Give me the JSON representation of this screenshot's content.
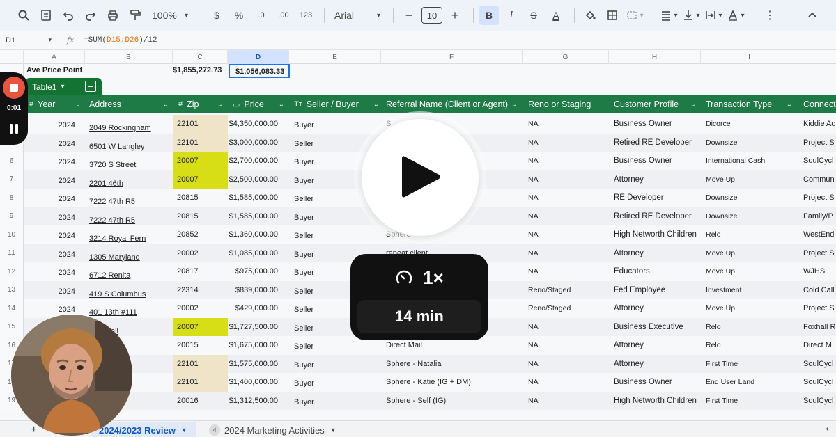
{
  "toolbar": {
    "zoom": "100%",
    "currency": "$",
    "percent": "%",
    "dec_decrease": ".0",
    "dec_increase": ".00",
    "number_format": "123",
    "font": "Arial",
    "font_size": "10",
    "bold": "B",
    "italic": "I",
    "strike": "S",
    "text_color": "A"
  },
  "formula_bar": {
    "cell_ref": "D1",
    "fx": "fx",
    "formula_prefix": "=SUM(",
    "formula_range": "D15:D26",
    "formula_suffix": ")/12"
  },
  "columns": [
    "A",
    "B",
    "C",
    "D",
    "E",
    "F",
    "G",
    "H",
    "I"
  ],
  "row1": {
    "label": "Ave Price Point",
    "c_value": "$1,855,272.73",
    "d_value": "$1,056,083.33"
  },
  "table_tab": {
    "name": "Table1"
  },
  "table_headers": [
    {
      "icon": "#",
      "label": "Year"
    },
    {
      "icon": "",
      "label": "Address"
    },
    {
      "icon": "#",
      "label": "Zip"
    },
    {
      "icon": "▭",
      "label": "Price"
    },
    {
      "icon": "Tт",
      "label": "Seller / Buyer"
    },
    {
      "icon": "",
      "label": "Referral Name (Client or Agent)"
    },
    {
      "icon": "",
      "label": "Reno or Staging"
    },
    {
      "icon": "",
      "label": "Customer Profile"
    },
    {
      "icon": "",
      "label": "Transaction Type"
    },
    {
      "icon": "",
      "label": "Connecti"
    }
  ],
  "rows": [
    {
      "n": "",
      "year": "2024",
      "address": "2049 Rockingham",
      "zip": "22101",
      "zipstyle": "tan",
      "price": "$4,350,000.00",
      "sb": "Buyer",
      "ref": "S",
      "reno": "NA",
      "profile": "Business Owner",
      "type": "Dicorce",
      "conn": "Kiddie Ac"
    },
    {
      "n": "",
      "year": "2024",
      "address": "6501 W Langley",
      "zip": "22101",
      "zipstyle": "tan",
      "price": "$3,000,000.00",
      "sb": "Seller",
      "ref": "",
      "reno": "NA",
      "profile": "Retired RE Developer",
      "type": "Downsize",
      "conn": "Project S"
    },
    {
      "n": "6",
      "year": "2024",
      "address": "3720 S Street",
      "zip": "20007",
      "zipstyle": "yellow",
      "price": "$2,700,000.00",
      "sb": "Buyer",
      "ref": "",
      "reno": "NA",
      "profile": "Business Owner",
      "type": "International Cash",
      "conn": "SoulCycl"
    },
    {
      "n": "7",
      "year": "2024",
      "address": "2201 46th",
      "zip": "20007",
      "zipstyle": "yellow",
      "price": "$2,500,000.00",
      "sb": "Buyer",
      "ref": "",
      "reno": "NA",
      "profile": "Attorney",
      "type": "Move Up",
      "conn": "Commun"
    },
    {
      "n": "8",
      "year": "2024",
      "address": "7222 47th R5",
      "zip": "20815",
      "zipstyle": "plain",
      "price": "$1,585,000.00",
      "sb": "Seller",
      "ref": "",
      "reno": "NA",
      "profile": "RE Developer",
      "type": "Downsize",
      "conn": "Project S"
    },
    {
      "n": "9",
      "year": "2024",
      "address": "7222 47th R5",
      "zip": "20815",
      "zipstyle": "plain",
      "price": "$1,585,000.00",
      "sb": "Buyer",
      "ref": "",
      "reno": "NA",
      "profile": "Retired RE Developer",
      "type": "Downsize",
      "conn": "Family/P"
    },
    {
      "n": "10",
      "year": "2024",
      "address": "3214 Royal Fern",
      "zip": "20852",
      "zipstyle": "plain",
      "price": "$1,360,000.00",
      "sb": "Seller",
      "ref": "Sphere",
      "reno": "NA",
      "profile": "High Networth Children",
      "type": "Relo",
      "conn": "WestEnd"
    },
    {
      "n": "11",
      "year": "2024",
      "address": "1305 Maryland",
      "zip": "20002",
      "zipstyle": "plain",
      "price": "$1,085,000.00",
      "sb": "Buyer",
      "ref": "repeat client",
      "reno": "NA",
      "profile": "Attorney",
      "type": "Move Up",
      "conn": "Project S"
    },
    {
      "n": "12",
      "year": "2024",
      "address": "6712 Renita",
      "zip": "20817",
      "zipstyle": "plain",
      "price": "$975,000.00",
      "sb": "Buyer",
      "ref": "",
      "reno": "NA",
      "profile": "Educators",
      "type": "Move Up",
      "conn": "WJHS"
    },
    {
      "n": "13",
      "year": "2024",
      "address": "419 S Columbus",
      "zip": "22314",
      "zipstyle": "plain",
      "price": "$839,000.00",
      "sb": "Seller",
      "ref": "",
      "reno": "Reno/Staged",
      "profile": "Fed Employee",
      "type": "Investment",
      "conn": "Cold Call"
    },
    {
      "n": "14",
      "year": "2024",
      "address": "401 13th #111",
      "zip": "20002",
      "zipstyle": "plain",
      "price": "$429,000.00",
      "sb": "Seller",
      "ref": "",
      "reno": "Reno/Staged",
      "profile": "Attorney",
      "type": "Move Up",
      "conn": "Project S"
    },
    {
      "n": "15",
      "year": "2024",
      "address": "Westhall",
      "zip": "20007",
      "zipstyle": "yellow",
      "price": "$1,727,500.00",
      "sb": "Seller",
      "ref": "",
      "reno": "NA",
      "profile": "Business Executive",
      "type": "Relo",
      "conn": "Foxhall R"
    },
    {
      "n": "16",
      "year": "2024",
      "address": "on",
      "zip": "20015",
      "zipstyle": "plain",
      "price": "$1,675,000.00",
      "sb": "Seller",
      "ref": "Direct Mail",
      "reno": "NA",
      "profile": "Attorney",
      "type": "Relo",
      "conn": "Direct M"
    },
    {
      "n": "17",
      "year": "2024",
      "address": "y",
      "zip": "22101",
      "zipstyle": "tan",
      "price": "$1,575,000.00",
      "sb": "Buyer",
      "ref": "Sphere - Natalia",
      "reno": "NA",
      "profile": "Attorney",
      "type": "First Time",
      "conn": "SoulCycl"
    },
    {
      "n": "18",
      "year": "2024",
      "address": "nt",
      "zip": "22101",
      "zipstyle": "tan",
      "price": "$1,400,000.00",
      "sb": "Buyer",
      "ref": "Sphere - Katie (IG + DM)",
      "reno": "NA",
      "profile": "Business Owner",
      "type": "End User Land",
      "conn": "SoulCycl"
    },
    {
      "n": "19",
      "year": "2024",
      "address": "rthur",
      "zip": "20016",
      "zipstyle": "plain",
      "price": "$1,312,500.00",
      "sb": "Buyer",
      "ref": "Sphere - Self (IG)",
      "reno": "NA",
      "profile": "High Networth Children",
      "type": "First Time",
      "conn": "SoulCycl"
    }
  ],
  "sheet_tabs": {
    "add": "+",
    "active": "2024/2023 Review",
    "second_badge": "4",
    "second": "2024 Marketing Activities"
  },
  "recorder": {
    "time": "0:01"
  },
  "player": {
    "speed": "1×",
    "duration": "14 min"
  },
  "colors": {
    "table_header": "#1e7b45",
    "zip_yellow": "#d7de16",
    "zip_tan": "#efe3c8",
    "record": "#e8543f"
  }
}
